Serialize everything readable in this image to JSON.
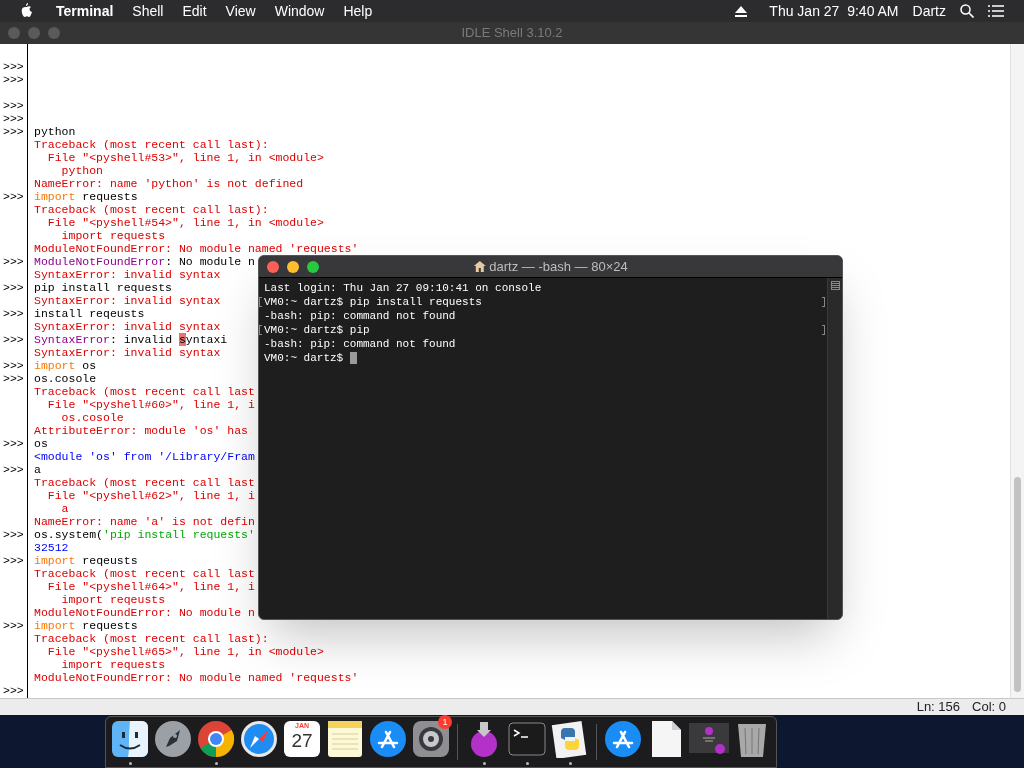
{
  "menu_bar": {
    "app": "Terminal",
    "items": [
      "Shell",
      "Edit",
      "View",
      "Window",
      "Help"
    ],
    "clock": "Thu Jan 27  9:40 AM",
    "user": "Dartz"
  },
  "idle_window": {
    "title": "IDLE Shell 3.10.2",
    "prompt": ">>>",
    "lines": [
      {
        "prompt": true
      },
      {
        "prompt": true
      },
      {
        "prompt": false
      },
      {
        "prompt": true
      },
      {
        "prompt": true
      },
      {
        "prompt": true,
        "segments": [
          {
            "kind": "input",
            "text": "python"
          }
        ]
      },
      {
        "prompt": false,
        "segments": [
          {
            "kind": "error",
            "text": "Traceback (most recent call last):"
          }
        ]
      },
      {
        "prompt": false,
        "segments": [
          {
            "kind": "error",
            "text": "  File \"<pyshell#53>\", line 1, in <module>"
          }
        ]
      },
      {
        "prompt": false,
        "segments": [
          {
            "kind": "error",
            "text": "    python"
          }
        ]
      },
      {
        "prompt": false,
        "segments": [
          {
            "kind": "error",
            "text": "NameError: name 'python' is not defined"
          }
        ]
      },
      {
        "prompt": true,
        "segments": [
          {
            "kind": "keyword",
            "text": "import"
          },
          {
            "kind": "input",
            "text": " requests"
          }
        ]
      },
      {
        "prompt": false,
        "segments": [
          {
            "kind": "error",
            "text": "Traceback (most recent call last):"
          }
        ]
      },
      {
        "prompt": false,
        "segments": [
          {
            "kind": "error",
            "text": "  File \"<pyshell#54>\", line 1, in <module>"
          }
        ]
      },
      {
        "prompt": false,
        "segments": [
          {
            "kind": "error",
            "text": "    import requests"
          }
        ]
      },
      {
        "prompt": false,
        "segments": [
          {
            "kind": "error",
            "text": "ModuleNotFoundError: No module named 'requests'"
          }
        ]
      },
      {
        "prompt": true,
        "segments": [
          {
            "kind": "builtin",
            "text": "ModuleNotFoundError"
          },
          {
            "kind": "input",
            "text": ": No module n"
          }
        ]
      },
      {
        "prompt": false,
        "segments": [
          {
            "kind": "error",
            "text": "SyntaxError: invalid syntax"
          }
        ]
      },
      {
        "prompt": true,
        "segments": [
          {
            "kind": "input",
            "text": "pip install requests"
          }
        ]
      },
      {
        "prompt": false,
        "segments": [
          {
            "kind": "error",
            "text": "SyntaxError: invalid syntax"
          }
        ]
      },
      {
        "prompt": true,
        "segments": [
          {
            "kind": "input",
            "text": "install reqeusts"
          }
        ]
      },
      {
        "prompt": false,
        "segments": [
          {
            "kind": "error",
            "text": "SyntaxError: invalid syntax"
          }
        ]
      },
      {
        "prompt": true,
        "segments": [
          {
            "kind": "builtin",
            "text": "SyntaxError"
          },
          {
            "kind": "input",
            "text": ": invalid "
          },
          {
            "kind": "highlight",
            "text": "s"
          },
          {
            "kind": "input",
            "text": "yntaxi"
          }
        ]
      },
      {
        "prompt": false,
        "segments": [
          {
            "kind": "error",
            "text": "SyntaxError: invalid syntax"
          }
        ]
      },
      {
        "prompt": true,
        "segments": [
          {
            "kind": "keyword",
            "text": "import"
          },
          {
            "kind": "input",
            "text": " os"
          }
        ]
      },
      {
        "prompt": true,
        "segments": [
          {
            "kind": "input",
            "text": "os.cosole"
          }
        ]
      },
      {
        "prompt": false,
        "segments": [
          {
            "kind": "error",
            "text": "Traceback (most recent call last"
          }
        ]
      },
      {
        "prompt": false,
        "segments": [
          {
            "kind": "error",
            "text": "  File \"<pyshell#60>\", line 1, i"
          }
        ]
      },
      {
        "prompt": false,
        "segments": [
          {
            "kind": "error",
            "text": "    os.cosole"
          }
        ]
      },
      {
        "prompt": false,
        "segments": [
          {
            "kind": "error",
            "text": "AttributeError: module 'os' has"
          }
        ]
      },
      {
        "prompt": true,
        "segments": [
          {
            "kind": "input",
            "text": "os"
          }
        ]
      },
      {
        "prompt": false,
        "segments": [
          {
            "kind": "output",
            "text": "<module 'os' from '/Library/Fram"
          }
        ]
      },
      {
        "prompt": true,
        "segments": [
          {
            "kind": "input",
            "text": "a"
          }
        ]
      },
      {
        "prompt": false,
        "segments": [
          {
            "kind": "error",
            "text": "Traceback (most recent call last"
          }
        ]
      },
      {
        "prompt": false,
        "segments": [
          {
            "kind": "error",
            "text": "  File \"<pyshell#62>\", line 1, i"
          }
        ]
      },
      {
        "prompt": false,
        "segments": [
          {
            "kind": "error",
            "text": "    a"
          }
        ]
      },
      {
        "prompt": false,
        "segments": [
          {
            "kind": "error",
            "text": "NameError: name 'a' is not defin"
          }
        ]
      },
      {
        "prompt": true,
        "segments": [
          {
            "kind": "input",
            "text": "os.system("
          },
          {
            "kind": "string",
            "text": "'pip install requests'"
          }
        ]
      },
      {
        "prompt": false,
        "segments": [
          {
            "kind": "output",
            "text": "32512"
          }
        ]
      },
      {
        "prompt": true,
        "segments": [
          {
            "kind": "keyword",
            "text": "import"
          },
          {
            "kind": "input",
            "text": " reqeusts"
          }
        ]
      },
      {
        "prompt": false,
        "segments": [
          {
            "kind": "error",
            "text": "Traceback (most recent call last"
          }
        ]
      },
      {
        "prompt": false,
        "segments": [
          {
            "kind": "error",
            "text": "  File \"<pyshell#64>\", line 1, i"
          }
        ]
      },
      {
        "prompt": false,
        "segments": [
          {
            "kind": "error",
            "text": "    import reqeusts"
          }
        ]
      },
      {
        "prompt": false,
        "segments": [
          {
            "kind": "error",
            "text": "ModuleNotFoundError: No module n"
          }
        ]
      },
      {
        "prompt": true,
        "segments": [
          {
            "kind": "keyword",
            "text": "import"
          },
          {
            "kind": "input",
            "text": " requests"
          }
        ]
      },
      {
        "prompt": false,
        "segments": [
          {
            "kind": "error",
            "text": "Traceback (most recent call last):"
          }
        ]
      },
      {
        "prompt": false,
        "segments": [
          {
            "kind": "error",
            "text": "  File \"<pyshell#65>\", line 1, in <module>"
          }
        ]
      },
      {
        "prompt": false,
        "segments": [
          {
            "kind": "error",
            "text": "    import requests"
          }
        ]
      },
      {
        "prompt": false,
        "segments": [
          {
            "kind": "error",
            "text": "ModuleNotFoundError: No module named 'requests'"
          }
        ]
      },
      {
        "prompt": true
      }
    ],
    "status": {
      "line": "Ln: 156",
      "column": "Col: 0"
    }
  },
  "terminal_window": {
    "title": "dartz — -bash — 80×24",
    "lines": [
      {
        "text": "Last login: Thu Jan 27 09:10:41 on console",
        "marked": false
      },
      {
        "text": "VM0:~ dartz$ pip install requests",
        "marked": true
      },
      {
        "text": "-bash: pip: command not found",
        "marked": false
      },
      {
        "text": "VM0:~ dartz$ pip",
        "marked": true
      },
      {
        "text": "-bash: pip: command not found",
        "marked": false
      },
      {
        "text": "VM0:~ dartz$ ",
        "marked": false,
        "cursor": true
      }
    ]
  },
  "dock": {
    "items": [
      {
        "kind": "finder",
        "running": true
      },
      {
        "kind": "launchpad",
        "running": false
      },
      {
        "kind": "chrome",
        "running": true
      },
      {
        "kind": "safari",
        "running": false
      },
      {
        "kind": "calendar",
        "running": false,
        "month": "JAN",
        "day": "27"
      },
      {
        "kind": "notes",
        "running": false
      },
      {
        "kind": "appstore",
        "running": false
      },
      {
        "kind": "preferences",
        "running": false,
        "badge": "1"
      },
      {
        "kind": "separator"
      },
      {
        "kind": "installer",
        "running": true
      },
      {
        "kind": "terminal",
        "running": true
      },
      {
        "kind": "python",
        "running": true
      },
      {
        "kind": "separator"
      },
      {
        "kind": "appstore",
        "running": false
      },
      {
        "kind": "document",
        "running": false
      },
      {
        "kind": "thumbnail",
        "running": false
      },
      {
        "kind": "trash",
        "running": false
      }
    ]
  }
}
